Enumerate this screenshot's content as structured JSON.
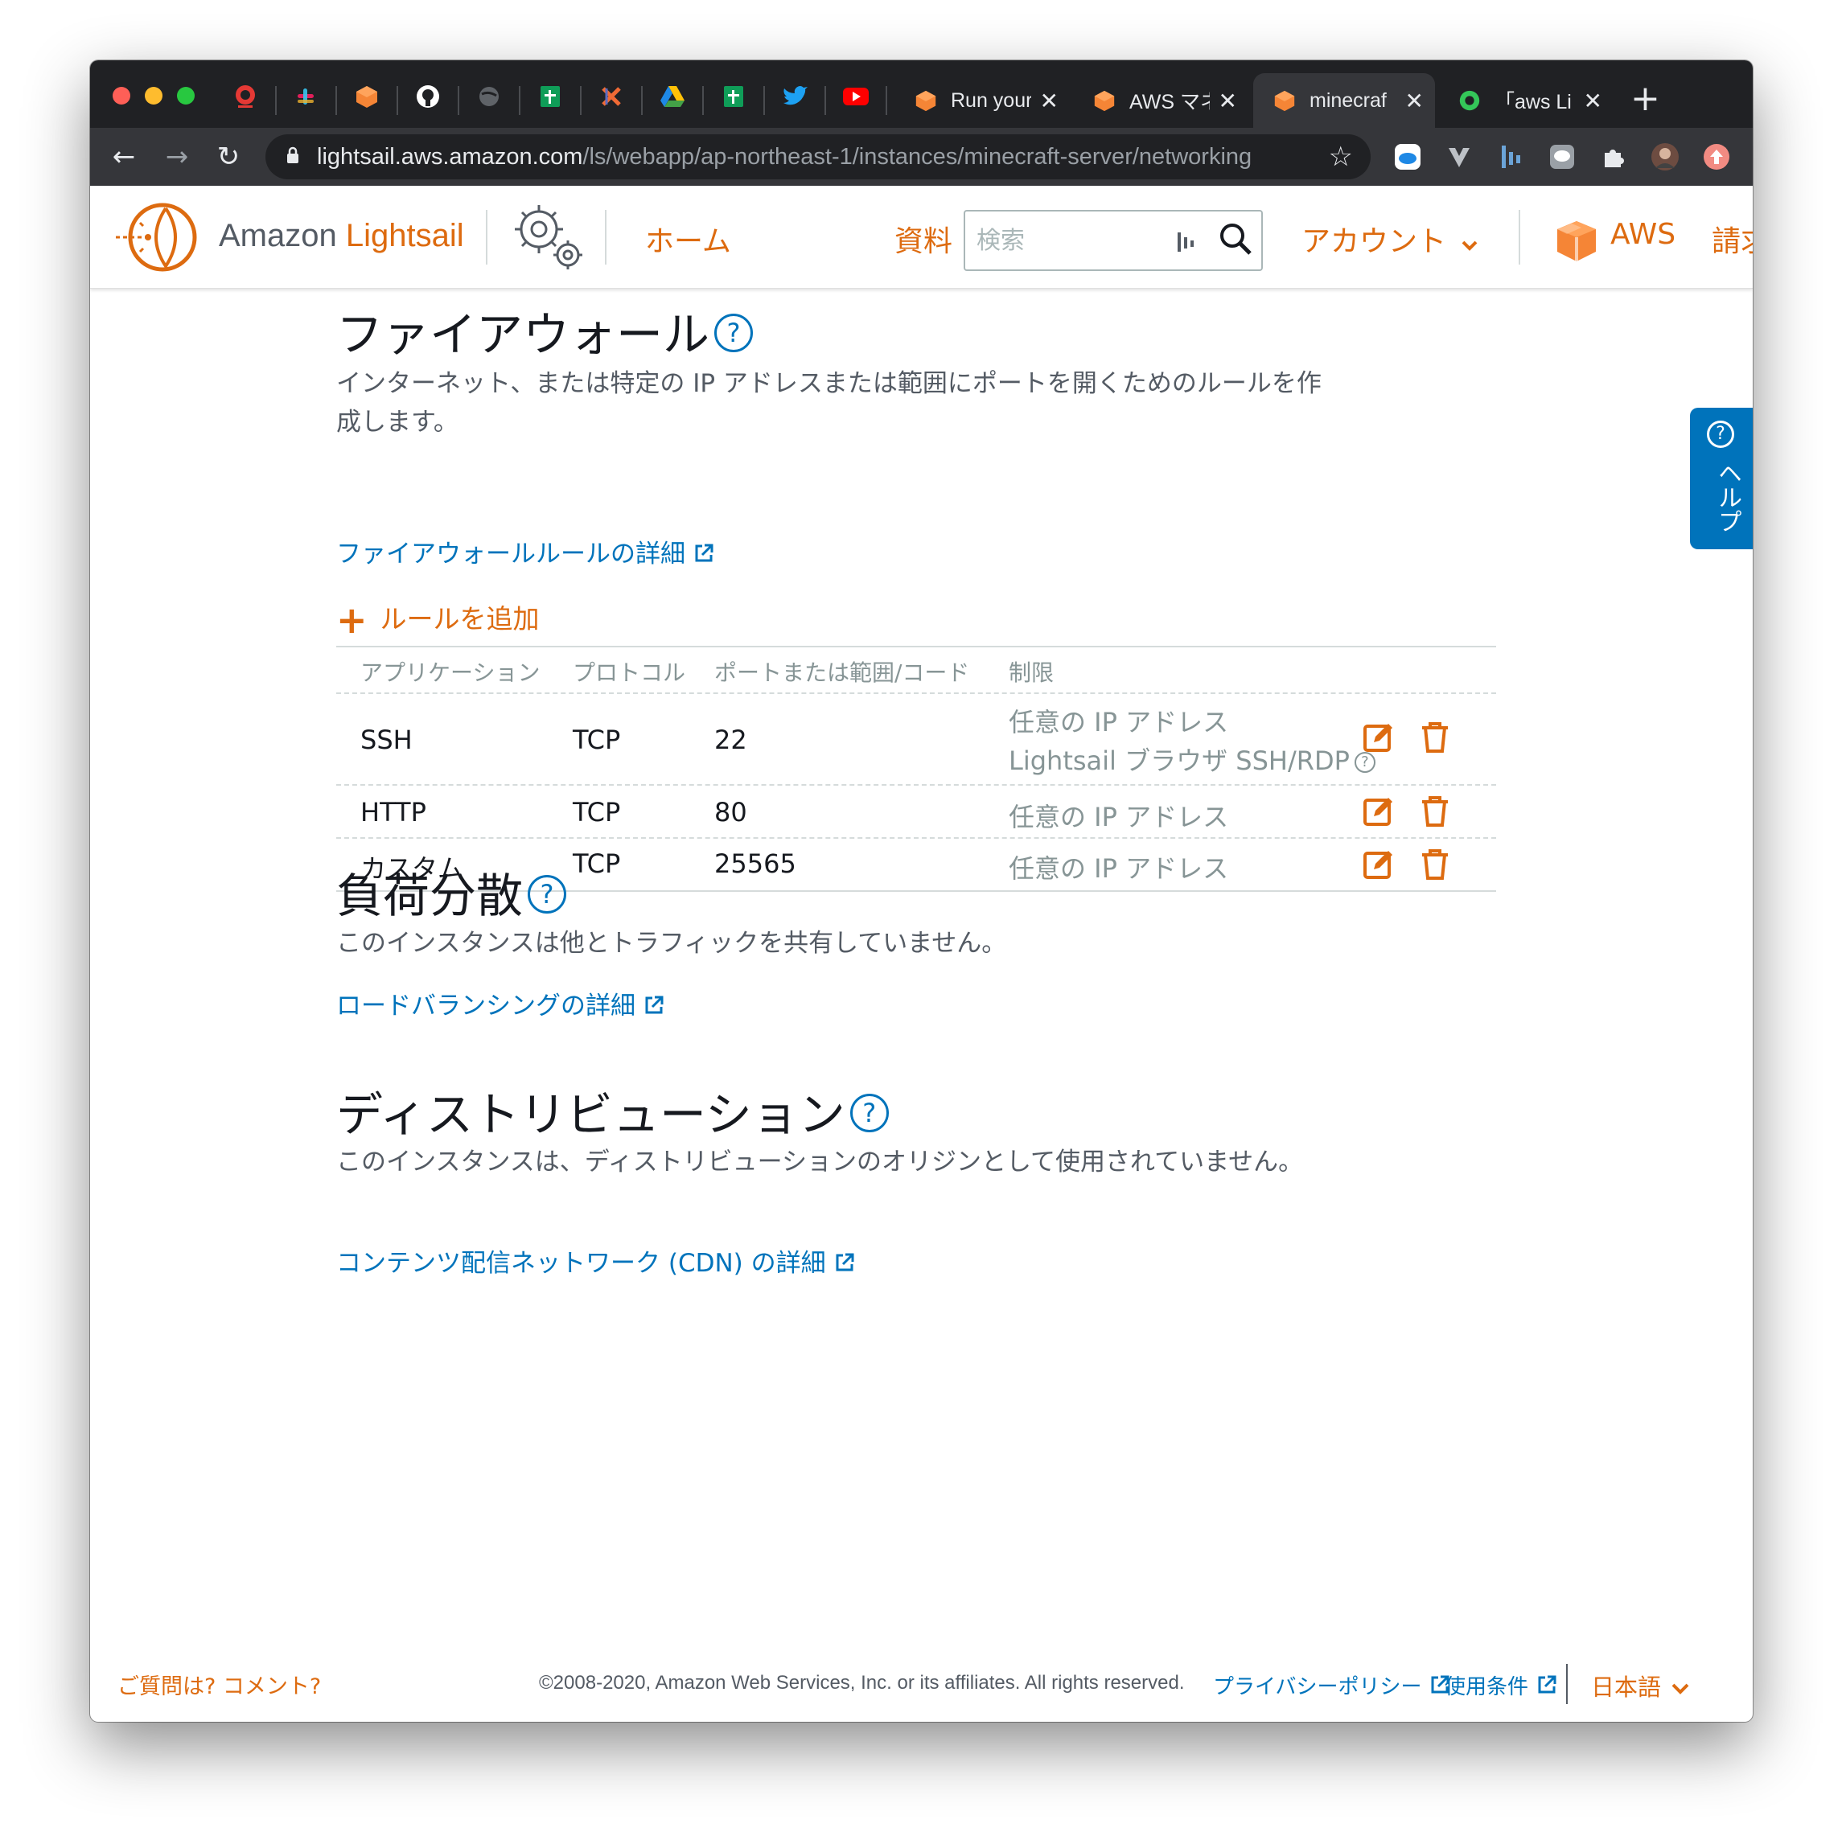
{
  "browser": {
    "tabs": [
      {
        "title": "Run your"
      },
      {
        "title": "AWS マネ"
      },
      {
        "title": "minecraf"
      },
      {
        "title": "「aws Li"
      }
    ],
    "new_tab": "+",
    "url_host": "lightsail.aws.amazon.com",
    "url_path": "/ls/webapp/ap-northeast-1/instances/minecraft-server/networking"
  },
  "header": {
    "brand_prefix": "Amazon",
    "brand_accent": "Lightsail",
    "home": "ホーム",
    "docs": "資料",
    "search_placeholder": "検索",
    "account": "アカウント",
    "aws": "AWS",
    "billing": "請求"
  },
  "help_tab": {
    "label": "ヘルプ",
    "icon": "?"
  },
  "firewall": {
    "title": "ファイアウォール",
    "description": "インターネット、または特定の IP アドレスまたは範囲にポートを開くためのルールを作成します。",
    "learn_more": "ファイアウォールルールの詳細",
    "add_rule": "ルールを追加",
    "columns": [
      "アプリケーション",
      "プロトコル",
      "ポートまたは範囲/コード",
      "制限"
    ],
    "rules": [
      {
        "application": "SSH",
        "protocol": "TCP",
        "port": "22",
        "restriction": "任意の IP アドレス",
        "restriction2": "Lightsail ブラウザ SSH/RDP"
      },
      {
        "application": "HTTP",
        "protocol": "TCP",
        "port": "80",
        "restriction": "任意の IP アドレス"
      },
      {
        "application": "カスタム",
        "protocol": "TCP",
        "port": "25565",
        "restriction": "任意の IP アドレス"
      }
    ]
  },
  "load_balancing": {
    "title": "負荷分散",
    "description": "このインスタンスは他とトラフィックを共有していません。",
    "learn_more": "ロードバランシングの詳細"
  },
  "distribution": {
    "title": "ディストリビューション",
    "description": "このインスタンスは、ディストリビューションのオリジンとして使用されていません。",
    "learn_more": "コンテンツ配信ネットワーク (CDN) の詳細"
  },
  "footer": {
    "feedback": "ご質問は? コメント?",
    "copyright": "©2008-2020, Amazon Web Services, Inc. or its affiliates. All rights reserved.",
    "privacy": "プライバシーポリシー",
    "terms": "使用条件",
    "language": "日本語"
  },
  "colors": {
    "accent": "#dd6b10",
    "link": "#0073bb",
    "text": "#16191f",
    "muted": "#879596"
  }
}
